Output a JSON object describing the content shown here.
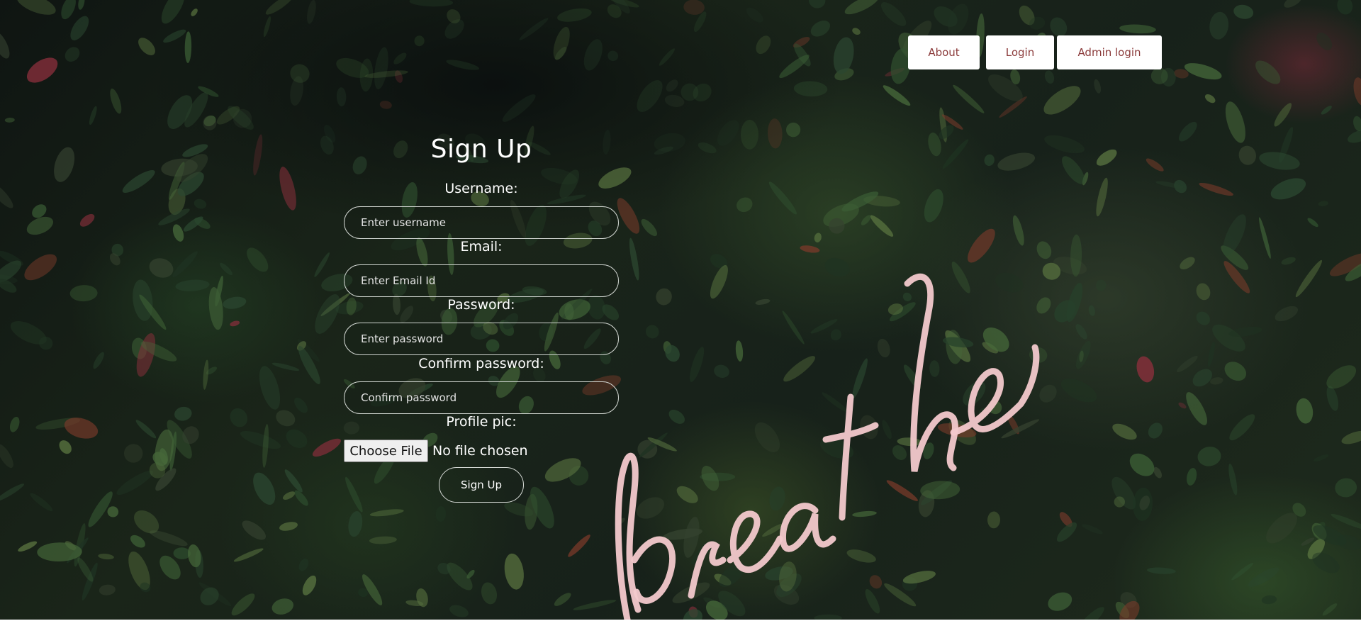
{
  "nav": {
    "about": "About",
    "login": "Login",
    "admin_login": "Admin login"
  },
  "form": {
    "title": "Sign Up",
    "username_label": "Username:",
    "username_placeholder": "Enter username",
    "email_label": "Email:",
    "email_placeholder": "Enter Email Id",
    "password_label": "Password:",
    "password_placeholder": "Enter password",
    "confirm_label": "Confirm password:",
    "confirm_placeholder": "Confirm password",
    "profile_label": "Profile pic:",
    "file_button": "Choose File",
    "file_status": "No file chosen",
    "submit": "Sign Up"
  },
  "background": {
    "neon_word": "breathe"
  },
  "colors": {
    "nav_text": "#8b3b3b",
    "neon": "#f3c9cc"
  }
}
